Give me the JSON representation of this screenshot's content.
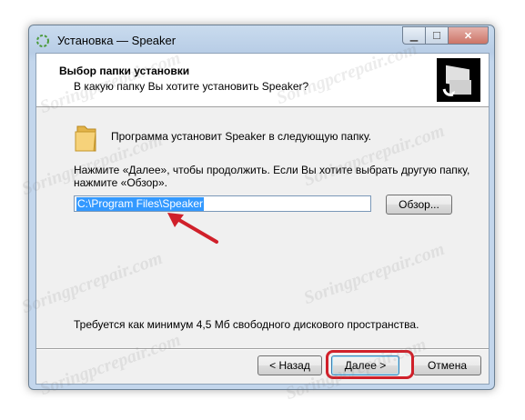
{
  "window": {
    "title": "Установка — Speaker",
    "controls": {
      "minimize": "▁",
      "maximize": "☐",
      "close": "✕"
    }
  },
  "header": {
    "title": "Выбор папки установки",
    "subtitle": "В какую папку Вы хотите установить Speaker?",
    "logo_icon": "installer-logo-icon"
  },
  "body": {
    "folder_icon": "folder-icon",
    "intro": "Программа установит Speaker в следующую папку.",
    "instructions_line1": "Нажмите «Далее», чтобы продолжить. Если Вы хотите выбрать другую папку,",
    "instructions_line2": "нажмите «Обзор».",
    "path_value": "C:\\Program Files\\Speaker",
    "browse_label": "Обзор...",
    "disk_space": "Требуется как минимум 4,5 Мб свободного дискового пространства."
  },
  "footer": {
    "back_label": "< Назад",
    "next_label": "Далее >",
    "cancel_label": "Отмена"
  },
  "colors": {
    "highlight": "#d0202a",
    "selection": "#3399ff",
    "title_bar": "#c3d6ec"
  },
  "watermark": "Soringpcrepair.com"
}
